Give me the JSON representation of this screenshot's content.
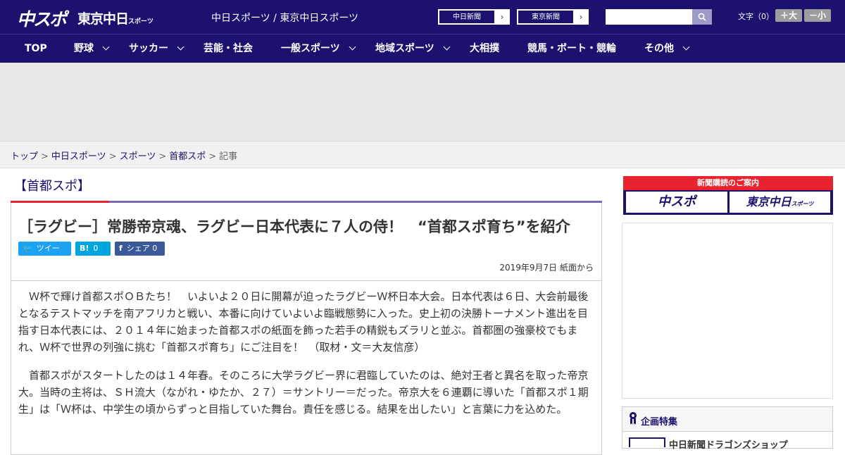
{
  "header": {
    "logo_main": "中スポ",
    "logo_tokyo": "東京中日",
    "logo_tokyo_sub": "スポーツ",
    "site_title": "中日スポーツ / 東京中日スポーツ",
    "paper_links": [
      "中日新聞",
      "東京新聞"
    ],
    "search_placeholder": "",
    "fontsize_label": "文字（0）",
    "fontsize_up": "＋大",
    "fontsize_down": "－小"
  },
  "nav": {
    "items": [
      {
        "label": "TOP",
        "has_menu": false
      },
      {
        "label": "野球",
        "has_menu": true
      },
      {
        "label": "サッカー",
        "has_menu": true
      },
      {
        "label": "芸能・社会",
        "has_menu": false
      },
      {
        "label": "一般スポーツ",
        "has_menu": true
      },
      {
        "label": "地域スポーツ",
        "has_menu": true
      },
      {
        "label": "大相撲",
        "has_menu": false
      },
      {
        "label": "競馬・ボート・競輪",
        "has_menu": false
      },
      {
        "label": "その他",
        "has_menu": true
      }
    ]
  },
  "breadcrumb": {
    "items": [
      "トップ",
      "中日スポーツ",
      "スポーツ",
      "首都スポ"
    ],
    "current": "記事"
  },
  "article": {
    "section": "【首都スポ】",
    "headline": "［ラグビー］常勝帝京魂、ラグビー日本代表に７人の侍！　“首都スポ育ち”を紹介",
    "share": {
      "twitter": "ツイート",
      "hatena_icon": "B!",
      "hatena_count": "0",
      "facebook": "シェア",
      "facebook_count": "0"
    },
    "date": "2019年9月7日 紙面から",
    "paragraphs": [
      "Ｗ杯で輝け首都スポＯＢたち！　いよいよ２０日に開幕が迫ったラグビーＷ杯日本大会。日本代表は６日、大会前最後となるテストマッチを南アフリカと戦い、本番に向けていよいよ臨戦態勢に入った。史上初の決勝トーナメント進出を目指す日本代表には、２０１４年に始まった首都スポの紙面を飾った若手の精鋭もズラリと並ぶ。首都圏の強豪校でもまれ、Ｗ杯で世界の列強に挑む「首都スポ育ち」にご注目を！　（取材・文＝大友信彦）",
      "首都スポがスタートしたのは１４年春。そのころに大学ラグビー界に君臨していたのは、絶対王者と異名を取った帝京大。当時の主将は、ＳＨ流大（ながれ・ゆたか、２７）＝サントリー＝だった。帝京大を６連覇に導いた「首都スポ１期生」は「Ｗ杯は、中学生の頃からずっと目指していた舞台。責任を感じる。結果を出したい」と言葉に力を込めた。"
    ]
  },
  "sidebar": {
    "subscribe_title": "新聞購読のご案内",
    "subscribe_left": "中スポ",
    "subscribe_right": "東京中日",
    "subscribe_right_sub": "スポーツ",
    "feature_title": "企画特集",
    "feature_item": "中日新聞ドラゴンズショップ"
  },
  "colors": {
    "brand_navy": "#1b116e",
    "accent_red": "#e8222e",
    "twitter": "#1da1f2",
    "hatena": "#00a4de",
    "facebook": "#3b5998"
  }
}
